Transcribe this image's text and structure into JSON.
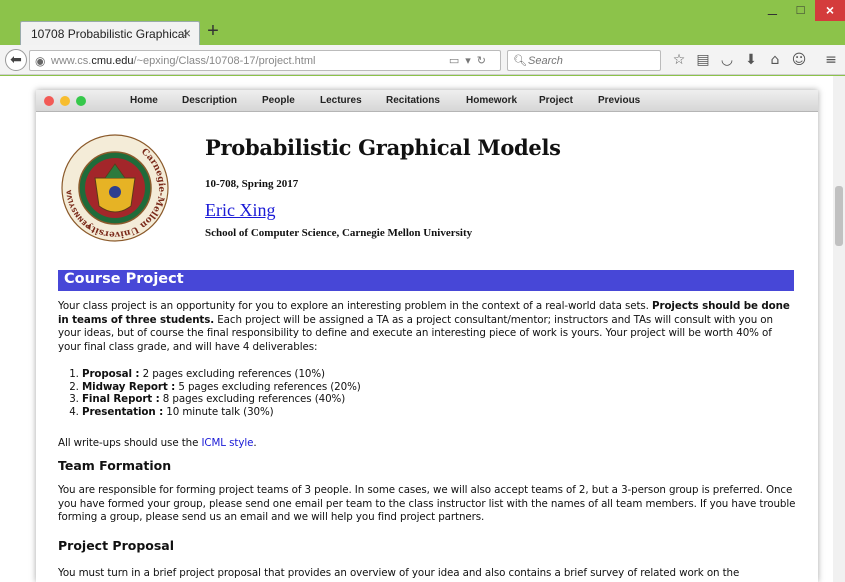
{
  "browser": {
    "tab_title": "10708 Probabilistic Graphical ...",
    "tab_close": "×",
    "new_tab": "+",
    "url_prefix": "www.cs.",
    "url_domain": "cmu.edu",
    "url_path": "/~epxing/Class/10708-17/project.html",
    "search_placeholder": "Search",
    "window_controls": {
      "minimize": "_",
      "maximize": "□",
      "close": "×"
    },
    "toolbar_icons": [
      "star-icon",
      "reading-list-icon",
      "pocket-icon",
      "download-icon",
      "home-icon",
      "sync-icon",
      "menu-icon"
    ]
  },
  "page": {
    "nav": [
      "Home",
      "Description",
      "People",
      "Lectures",
      "Recitations",
      "Homework",
      "Project",
      "Previous"
    ],
    "seal": {
      "top_text": "Carnegie-Mellon",
      "right_text": "University",
      "left_text": "Pittsburgh",
      "bottom_text": "Pennsylvania 1900"
    },
    "title": "Probabilistic Graphical Models",
    "subtitle": "10-708, Spring 2017",
    "author": "Eric Xing",
    "affiliation": "School of Computer Science, Carnegie Mellon University",
    "section_title": "Course Project",
    "intro": {
      "text1": "Your class project is an opportunity for you to explore an interesting problem in the context of a real-world data sets. ",
      "bold": "Projects should be done in teams of three students.",
      "text2": " Each project will be assigned a TA as a project consultant/mentor; instructors and TAs will consult with you on your ideas, but of course the final responsibility to define and execute an interesting piece of work is yours. Your project will be worth 40% of your final class grade, and will have 4 deliverables:"
    },
    "deliverables": [
      {
        "name": "Proposal :",
        "detail": " 2 pages excluding references (10%)"
      },
      {
        "name": "Midway Report :",
        "detail": " 5 pages excluding references (20%)"
      },
      {
        "name": "Final Report :",
        "detail": " 8 pages excluding references (40%)"
      },
      {
        "name": "Presentation :",
        "detail": " 10 minute talk (30%)"
      }
    ],
    "writeups": {
      "text": "All write-ups should use the ",
      "link": "ICML style",
      "end": "."
    },
    "team_heading": "Team Formation",
    "team_text": "You are responsible for forming project teams of 3 people. In some cases, we will also accept teams of 2, but a 3-person group is preferred. Once you have formed your group, please send one email per team to the class instructor list with the names of all team members. If you have trouble forming a group, please send us an email and we will help you find project partners.",
    "proposal_heading": "Project Proposal",
    "proposal_text": "You must turn in a brief project proposal that provides an overview of your idea and also contains a brief survey of related work on the"
  },
  "colors": {
    "chrome": "#8cc34a",
    "section_bar": "#4747d7",
    "link": "#1a1ad6"
  }
}
